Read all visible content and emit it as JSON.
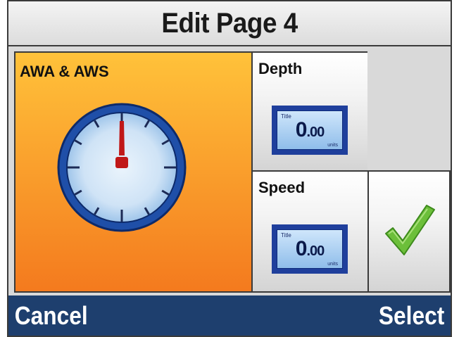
{
  "title": "Edit Page 4",
  "panels": {
    "main": {
      "label": "AWA & AWS",
      "icon": "analog-dial-icon"
    },
    "depth": {
      "label": "Depth",
      "display_title": "Title",
      "value_int": "0",
      "value_dec": ".00",
      "units": "units"
    },
    "speed": {
      "label": "Speed",
      "display_title": "Title",
      "value_int": "0",
      "value_dec": ".00",
      "units": "units"
    },
    "confirm": {
      "icon": "checkmark-icon"
    }
  },
  "softkeys": {
    "left": "Cancel",
    "right": "Select"
  },
  "colors": {
    "accent_orange_top": "#ffc23a",
    "accent_orange_bottom": "#f47a1e",
    "bottom_bar": "#1e3f6e",
    "gauge_ring": "#1f4fa8",
    "needle": "#cc1a1a",
    "check_green": "#6cbf3a"
  }
}
